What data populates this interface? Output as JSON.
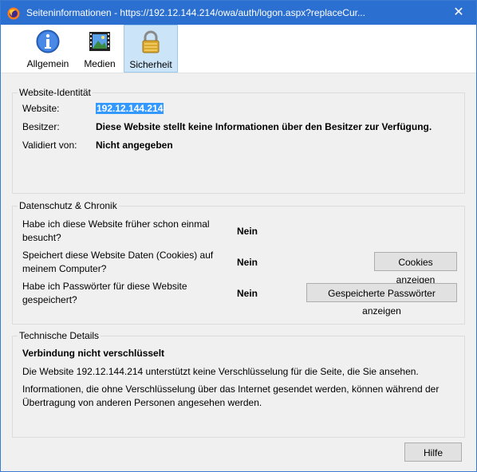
{
  "window": {
    "title": "Seiteninformationen - https://192.12.144.214/owa/auth/logon.aspx?replaceCur...",
    "close_glyph": "✕"
  },
  "tabs": [
    {
      "label": "Allgemein",
      "icon": "info-icon"
    },
    {
      "label": "Medien",
      "icon": "media-icon"
    },
    {
      "label": "Sicherheit",
      "icon": "lock-icon",
      "selected": true
    }
  ],
  "identity": {
    "title": "Website-Identität",
    "website_label": "Website:",
    "website_value": "192.12.144.214",
    "owner_label": "Besitzer:",
    "owner_value": "Diese Website stellt keine Informationen über den Besitzer zur Verfügung.",
    "validated_label": "Validiert von:",
    "validated_value": "Nicht angegeben"
  },
  "privacy": {
    "title": "Datenschutz & Chronik",
    "q1_line1": "Habe ich diese Website früher schon einmal",
    "q1_line2": "besucht?",
    "a1": "Nein",
    "q2_line1": "Speichert diese Website Daten (Cookies) auf",
    "q2_line2": "meinem Computer?",
    "a2": "Nein",
    "cookies_button": "Cookies anzeigen",
    "q3_line1": "Habe ich Passwörter für diese Website",
    "q3_line2": "gespeichert?",
    "a3": "Nein",
    "passwords_button": "Gespeicherte Passwörter anzeigen"
  },
  "technical": {
    "title": "Technische Details",
    "heading": "Verbindung nicht verschlüsselt",
    "line1": "Die Website 192.12.144.214 unterstützt keine Verschlüsselung für die Seite, die Sie ansehen.",
    "line2": "Informationen, die ohne Verschlüsselung über das Internet gesendet werden, können während der",
    "line3": "Übertragung von anderen Personen angesehen werden."
  },
  "footer": {
    "help_button": "Hilfe"
  }
}
